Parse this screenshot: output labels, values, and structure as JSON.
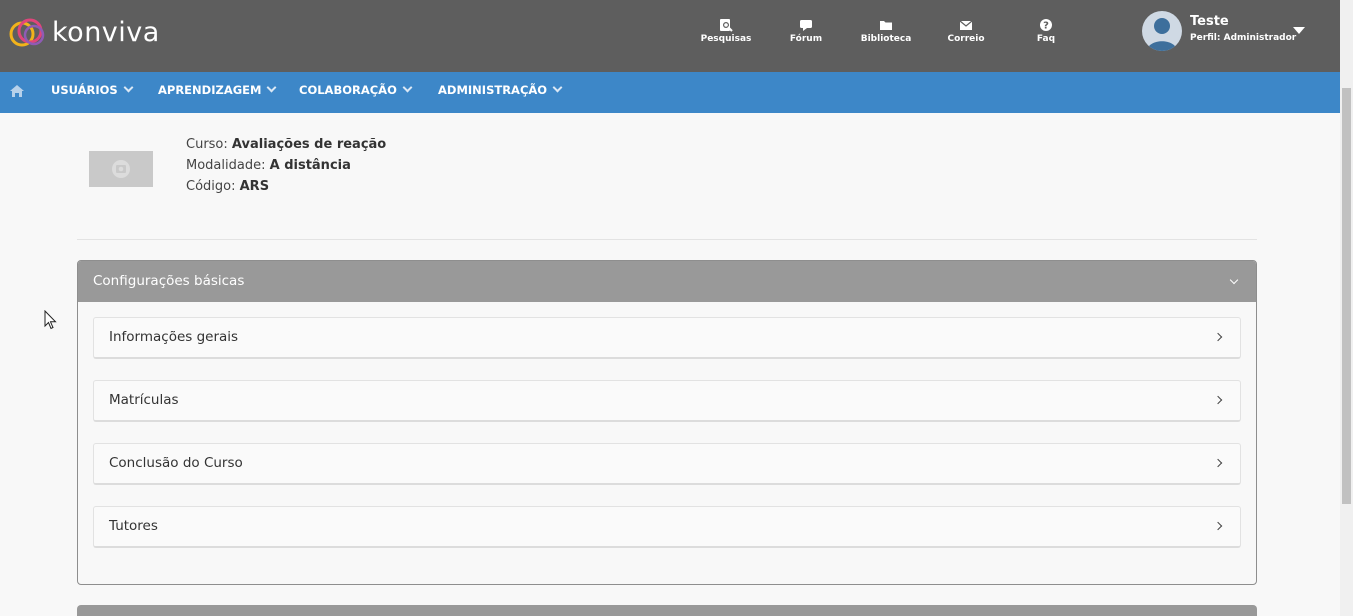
{
  "app": {
    "logo_text": "konviva"
  },
  "topnav": {
    "items": [
      {
        "label": "Pesquisas",
        "icon": "survey-icon"
      },
      {
        "label": "Fórum",
        "icon": "chat-bubble-icon"
      },
      {
        "label": "Biblioteca",
        "icon": "folder-icon"
      },
      {
        "label": "Correio",
        "icon": "envelope-icon"
      },
      {
        "label": "Faq",
        "icon": "question-icon"
      }
    ]
  },
  "user": {
    "name": "Teste",
    "role": "Perfil: Administrador"
  },
  "menu": {
    "items": [
      {
        "label": "USUÁRIOS"
      },
      {
        "label": "APRENDIZAGEM"
      },
      {
        "label": "COLABORAÇÃO"
      },
      {
        "label": "ADMINISTRAÇÃO"
      }
    ]
  },
  "course": {
    "curso_label": "Curso:",
    "curso_value": "Avaliações de reação",
    "modalidade_label": "Modalidade:",
    "modalidade_value": "A distância",
    "codigo_label": "Código:",
    "codigo_value": "ARS"
  },
  "panel": {
    "title": "Configurações básicas",
    "rows": [
      {
        "label": "Informações gerais"
      },
      {
        "label": "Matrículas"
      },
      {
        "label": "Conclusão do Curso"
      },
      {
        "label": "Tutores"
      }
    ]
  },
  "colors": {
    "topbar": "#5e5e5e",
    "menubar": "#3d87c8",
    "panel_header": "#999999"
  }
}
